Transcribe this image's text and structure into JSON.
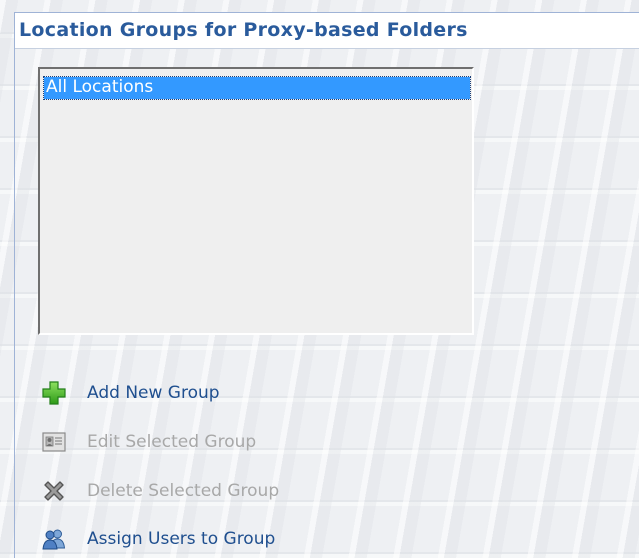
{
  "header": {
    "title": "Location Groups for Proxy-based Folders"
  },
  "groups_list": {
    "items": [
      {
        "label": "All Locations",
        "selected": true
      }
    ]
  },
  "actions": {
    "add": {
      "label": "Add New Group",
      "icon": "plus-icon",
      "enabled": true,
      "color": "#1f4f8f"
    },
    "edit": {
      "label": "Edit Selected Group",
      "icon": "id-card-icon",
      "enabled": false,
      "color": "#a8a8a8"
    },
    "delete": {
      "label": "Delete Selected Group",
      "icon": "x-mark-icon",
      "enabled": false,
      "color": "#a8a8a8"
    },
    "assign": {
      "label": "Assign Users to Group",
      "icon": "users-icon",
      "enabled": true,
      "color": "#1f4f8f"
    }
  },
  "colors": {
    "header_text": "#2a5b9c",
    "selection": "#3399ff",
    "add_icon": "#33b021"
  }
}
